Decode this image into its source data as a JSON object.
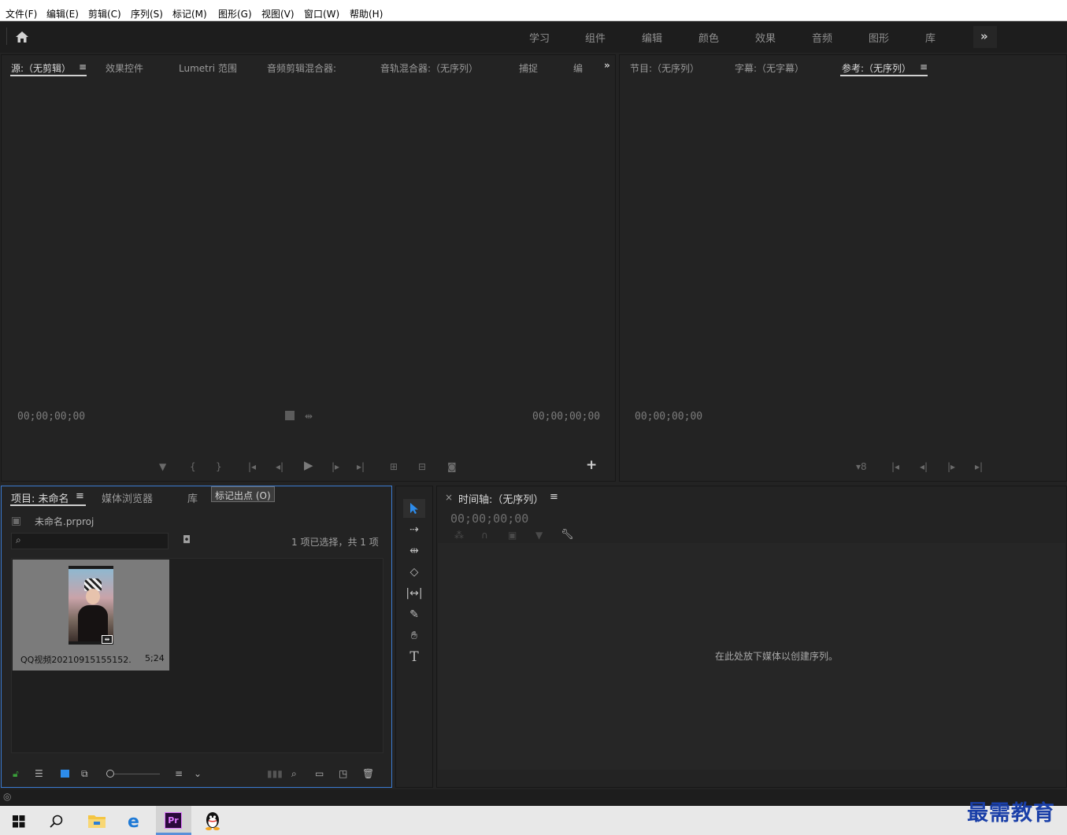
{
  "menubar": {
    "items": [
      "文件(F)",
      "编辑(E)",
      "剪辑(C)",
      "序列(S)",
      "标记(M)",
      "图形(G)",
      "视图(V)",
      "窗口(W)",
      "帮助(H)"
    ]
  },
  "workspaces": {
    "items": [
      "学习",
      "组件",
      "编辑",
      "颜色",
      "效果",
      "音频",
      "图形",
      "库"
    ],
    "more": "»"
  },
  "source_panel": {
    "tabs": [
      "源:（无剪辑）",
      "效果控件",
      "Lumetri 范围",
      "音频剪辑混合器:",
      "音轨混合器:（无序列）",
      "捕捉",
      "编"
    ],
    "menu_icon": "≡",
    "more": "»",
    "timecode_left": "00;00;00;00",
    "timecode_right": "00;00;00;00"
  },
  "program_panel": {
    "tabs": [
      "节目:（无序列）",
      "字幕:（无字幕）",
      "参考:（无序列）"
    ],
    "menu_icon": "≡",
    "timecode_left": "00;00;00;00"
  },
  "project_panel": {
    "tabs": [
      "项目: 未命名",
      "媒体浏览器",
      "库"
    ],
    "menu_icon": "≡",
    "tooltip": "标记出点 (O)",
    "file_name": "未命名.prproj",
    "search_placeholder": "",
    "selection_info": "1 项已选择，共 1 项",
    "clip": {
      "name": "QQ视频20210915155152...",
      "duration": "5;24"
    }
  },
  "timeline_panel": {
    "close": "×",
    "title": "时间轴:（无序列）",
    "menu_icon": "≡",
    "timecode": "00;00;00;00",
    "empty_message": "在此处放下媒体以创建序列。"
  },
  "colors": {
    "accent": "#2d8ceb",
    "panel_bg": "#232323",
    "menu_bg": "#ffffff",
    "focus_border": "#3b7bd1"
  },
  "watermark": "最需教育",
  "taskbar": {
    "apps": [
      "windows-start-icon",
      "search-icon",
      "file-explorer-icon",
      "edge-icon",
      "premiere-icon",
      "qq-icon"
    ],
    "premiere_label": "Pr"
  }
}
